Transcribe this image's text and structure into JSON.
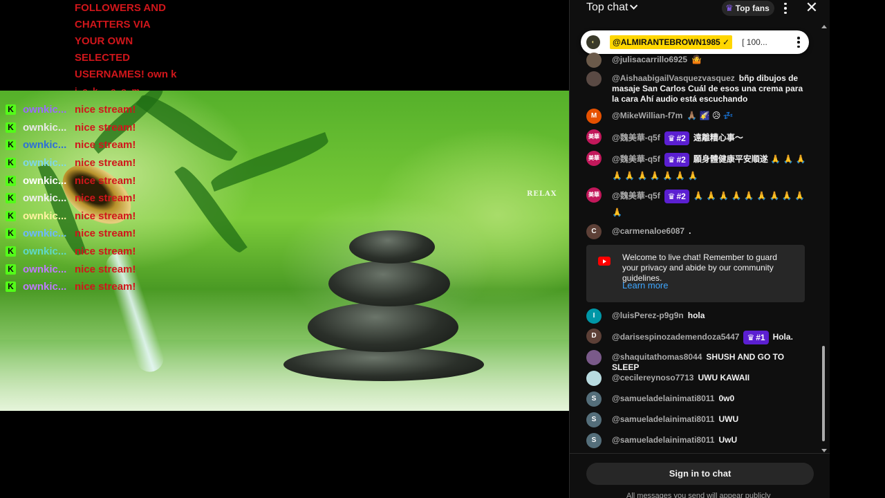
{
  "overlay": {
    "lines": [
      "FOLLOWERS AND",
      "CHATTERS VIA",
      "YOUR OWN",
      "SELECTED",
      "USERNAMES! own k",
      "i c k . c o m"
    ]
  },
  "video": {
    "watermark": "RELAX"
  },
  "kick_chat": [
    {
      "user": "ownkic...",
      "message": "nice stream!",
      "color": "#9b6bff"
    },
    {
      "user": "ownkic...",
      "message": "nice stream!",
      "color": "#e8e8e8"
    },
    {
      "user": "ownkic...",
      "message": "nice stream!",
      "color": "#2e6fd8"
    },
    {
      "user": "ownkic...",
      "message": "nice stream!",
      "color": "#7fd8e8"
    },
    {
      "user": "ownkic...",
      "message": "nice stream!",
      "color": "#ffffff"
    },
    {
      "user": "ownkic...",
      "message": "nice stream!",
      "color": "#f0f0f0"
    },
    {
      "user": "ownkic...",
      "message": "nice stream!",
      "color": "#fff3a0"
    },
    {
      "user": "ownkic...",
      "message": "nice stream!",
      "color": "#6bb8ff"
    },
    {
      "user": "ownkic...",
      "message": "nice stream!",
      "color": "#5fd8c8"
    },
    {
      "user": "ownkic...",
      "message": "nice stream!",
      "color": "#c07aff"
    },
    {
      "user": "ownkic...",
      "message": "nice stream!",
      "color": "#c07aff"
    }
  ],
  "chat": {
    "title": "Top chat",
    "top_fans_label": "Top fans",
    "pinned": {
      "user": "@ALMIRANTEBROWN1985 ✓",
      "text": "[ 100..."
    },
    "messages": [
      {
        "initial": "",
        "avatar_color": "#6b5a4a",
        "author": "@julisacarrillo6925",
        "badge": "",
        "text": "🤷"
      },
      {
        "initial": "",
        "avatar_color": "#5a4a44",
        "author": "@AishaabigailVasquezvasquez",
        "badge": "",
        "text": "bñp dibujos de masaje San Carlos Cuál de esos una crema para la cara Ahí audio está escuchando"
      },
      {
        "initial": "M",
        "avatar_color": "#e65100",
        "author": "@MikeWillian-f7m",
        "badge": "",
        "text": "🙏🏽 🌠 😥 💤"
      },
      {
        "initial": "美華",
        "avatar_color": "#c2185b",
        "author": "@魏美華-q5f",
        "badge": "#2",
        "text": "遠離糟心事～"
      },
      {
        "initial": "美華",
        "avatar_color": "#c2185b",
        "author": "@魏美華-q5f",
        "badge": "#2",
        "text": "願身體健康平安順遂 🙏 🙏 🙏 🙏 🙏 🙏 🙏 🙏 🙏 🙏"
      },
      {
        "initial": "美華",
        "avatar_color": "#c2185b",
        "author": "@魏美華-q5f",
        "badge": "#2",
        "text": "🙏 🙏 🙏 🙏 🙏 🙏 🙏 🙏 🙏 🙏"
      },
      {
        "initial": "C",
        "avatar_color": "#5d4037",
        "author": "@carmenaloe6087",
        "badge": "",
        "text": "."
      },
      {
        "initial": "I",
        "avatar_color": "#0097a7",
        "author": "@luisPerez-p9g9n",
        "badge": "",
        "text": "hola"
      },
      {
        "initial": "D",
        "avatar_color": "#5d4037",
        "author": "@darisespinozademendoza5447",
        "badge": "#1",
        "text": "Hola."
      },
      {
        "initial": "",
        "avatar_color": "#7a5a8a",
        "author": "@shaquitathomas8044",
        "badge": "",
        "text": "SHUSH AND GO TO SLEEP"
      },
      {
        "initial": "",
        "avatar_color": "#b8dbe0",
        "author": "@cecilereynoso7713",
        "badge": "",
        "text": "UWU KAWAII"
      },
      {
        "initial": "S",
        "avatar_color": "#546e7a",
        "author": "@samueladelainimati8011",
        "badge": "",
        "text": "0w0"
      },
      {
        "initial": "S",
        "avatar_color": "#546e7a",
        "author": "@samueladelainimati8011",
        "badge": "",
        "text": "UWU"
      },
      {
        "initial": "S",
        "avatar_color": "#546e7a",
        "author": "@samueladelainimati8011",
        "badge": "",
        "text": "UwU"
      }
    ],
    "welcome": {
      "text": "Welcome to live chat! Remember to guard your privacy and abide by our community guidelines.",
      "link": "Learn more"
    },
    "sign_in_label": "Sign in to chat",
    "footer_note": "All messages you send will appear publicly"
  }
}
